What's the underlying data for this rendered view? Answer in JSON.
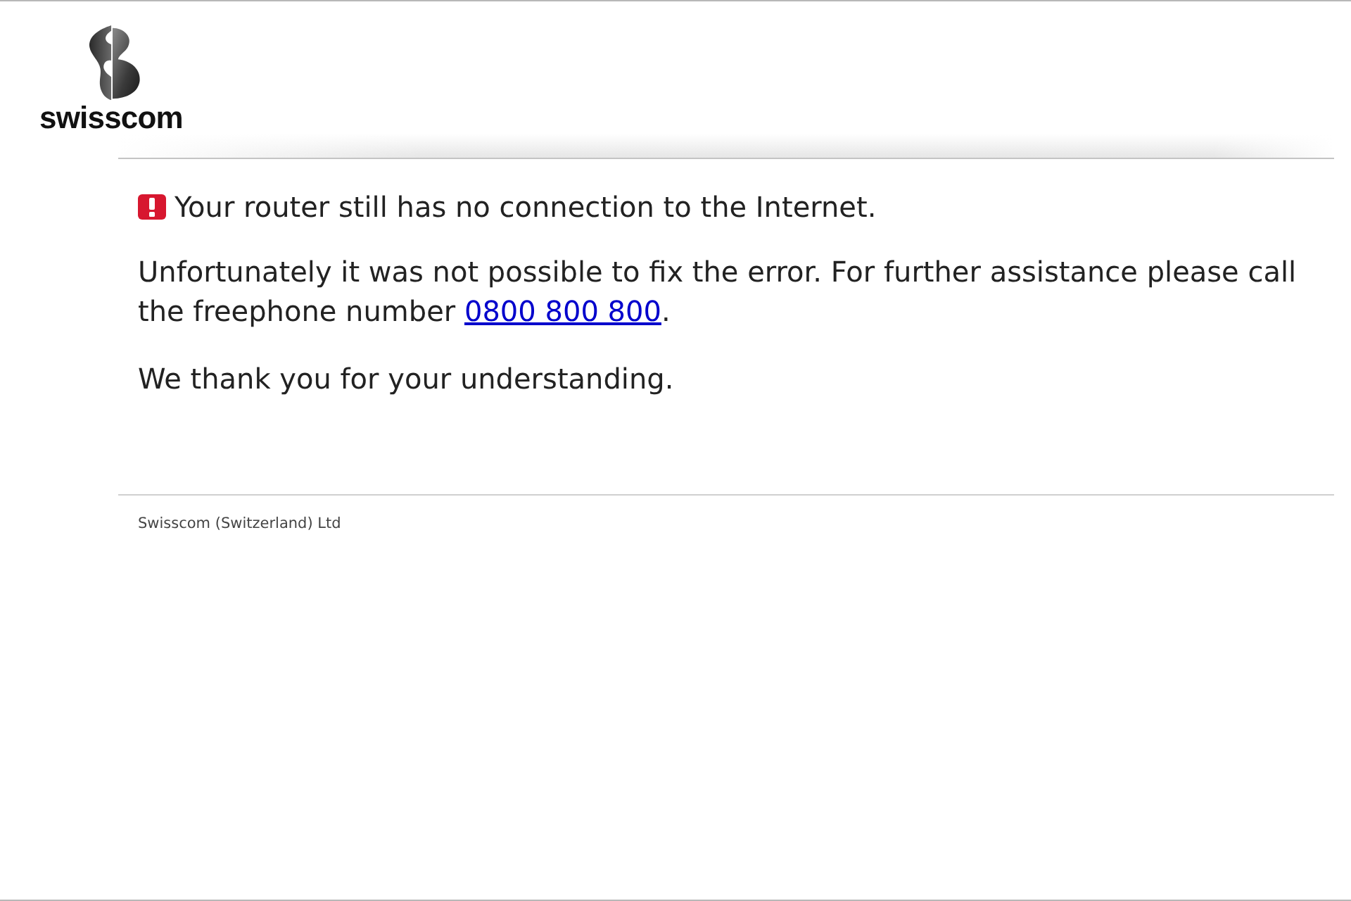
{
  "header": {
    "logo_text": "swisscom"
  },
  "message": {
    "title": "Your router still has no connection to the Internet."
  },
  "paragraphs": [
    {
      "kind": "with_link",
      "text": "Unfortunately it was not possible to fix the error. For further assistance please call the freephone number",
      "link": "0800 800 800",
      "after": "."
    },
    {
      "kind": "text",
      "text": "We thank you for your understanding."
    }
  ],
  "footer": {
    "text": "Swisscom (Switzerland) Ltd"
  }
}
